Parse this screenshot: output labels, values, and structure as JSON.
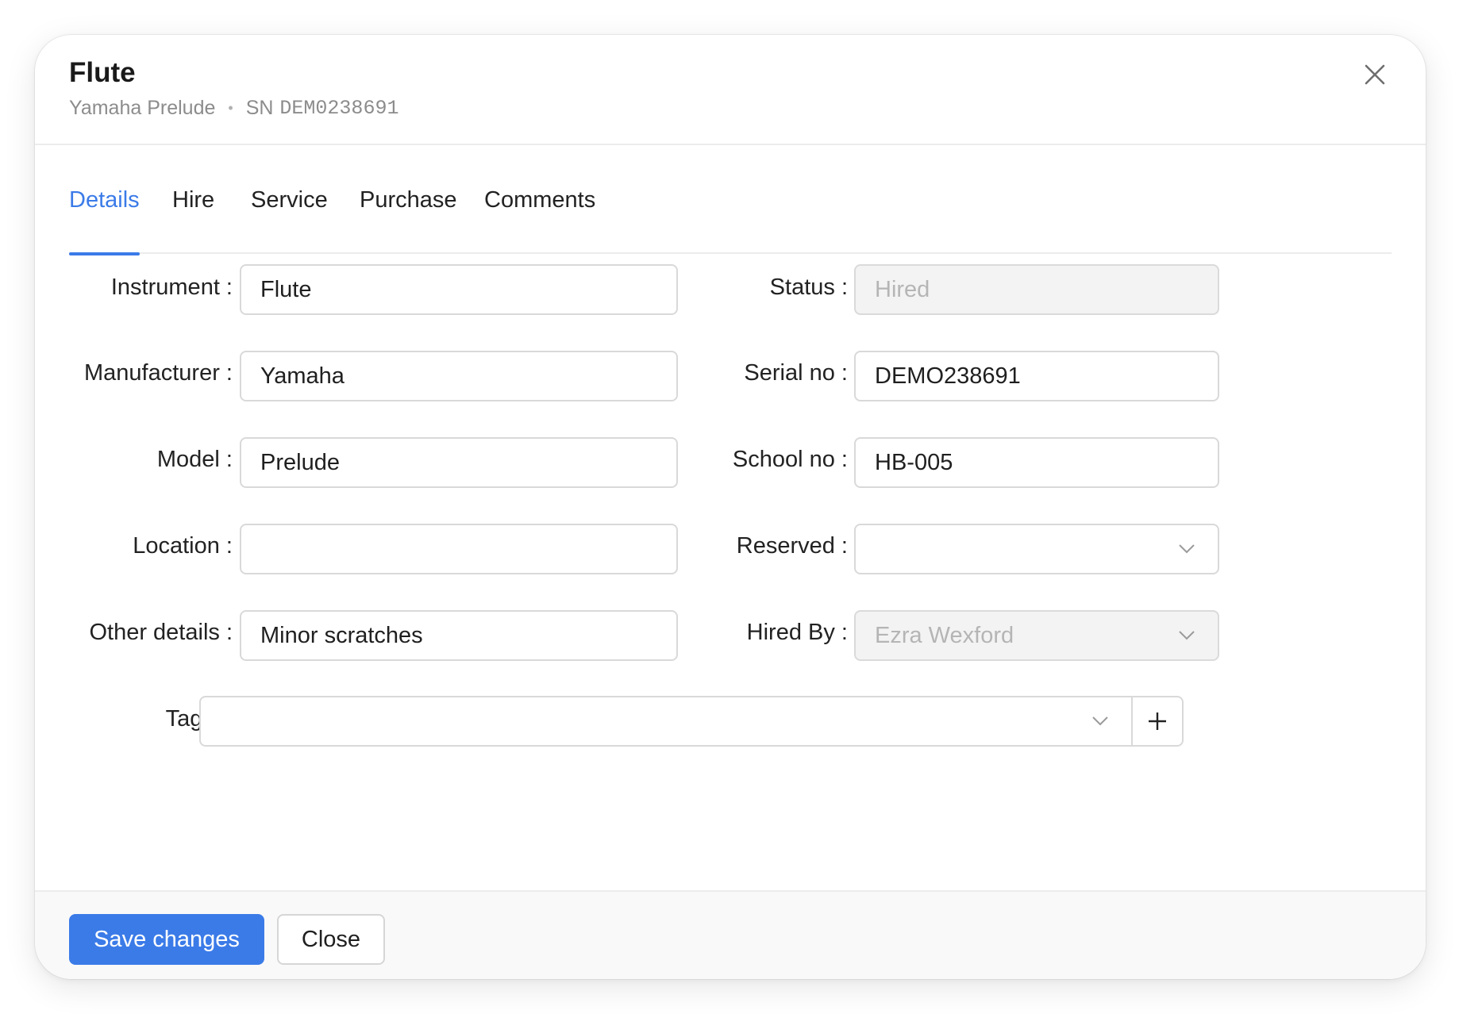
{
  "dialog": {
    "title": "Flute",
    "subtitle_instrument": "Yamaha Prelude",
    "subtitle_sn_prefix": "SN",
    "subtitle_serial": "DEM0238691",
    "close_icon": "close-icon"
  },
  "tabs": [
    {
      "label": "Details",
      "active": true
    },
    {
      "label": "Hire",
      "active": false
    },
    {
      "label": "Service",
      "active": false
    },
    {
      "label": "Purchase",
      "active": false
    },
    {
      "label": "Comments",
      "active": false
    }
  ],
  "form": {
    "instrument": {
      "label": "Instrument :",
      "value": "Flute"
    },
    "manufacturer": {
      "label": "Manufacturer :",
      "value": "Yamaha"
    },
    "model": {
      "label": "Model :",
      "value": "Prelude"
    },
    "location": {
      "label": "Location :",
      "value": ""
    },
    "other_details": {
      "label": "Other details :",
      "value": "Minor scratches"
    },
    "status": {
      "label": "Status :",
      "value": "Hired",
      "disabled": true
    },
    "serial_no": {
      "label": "Serial no :",
      "value": "DEMO238691"
    },
    "school_no": {
      "label": "School no :",
      "value": "HB-005"
    },
    "reserved": {
      "label": "Reserved :",
      "value": ""
    },
    "hired_by": {
      "label": "Hired By :",
      "value": "Ezra Wexford",
      "disabled": true
    },
    "tags": {
      "label": "Tags :",
      "value": ""
    }
  },
  "footer": {
    "save_label": "Save changes",
    "close_label": "Close"
  },
  "colors": {
    "accent": "#3b7be8",
    "disabled_bg": "#f3f3f3",
    "disabled_text": "#b5b5b5"
  }
}
